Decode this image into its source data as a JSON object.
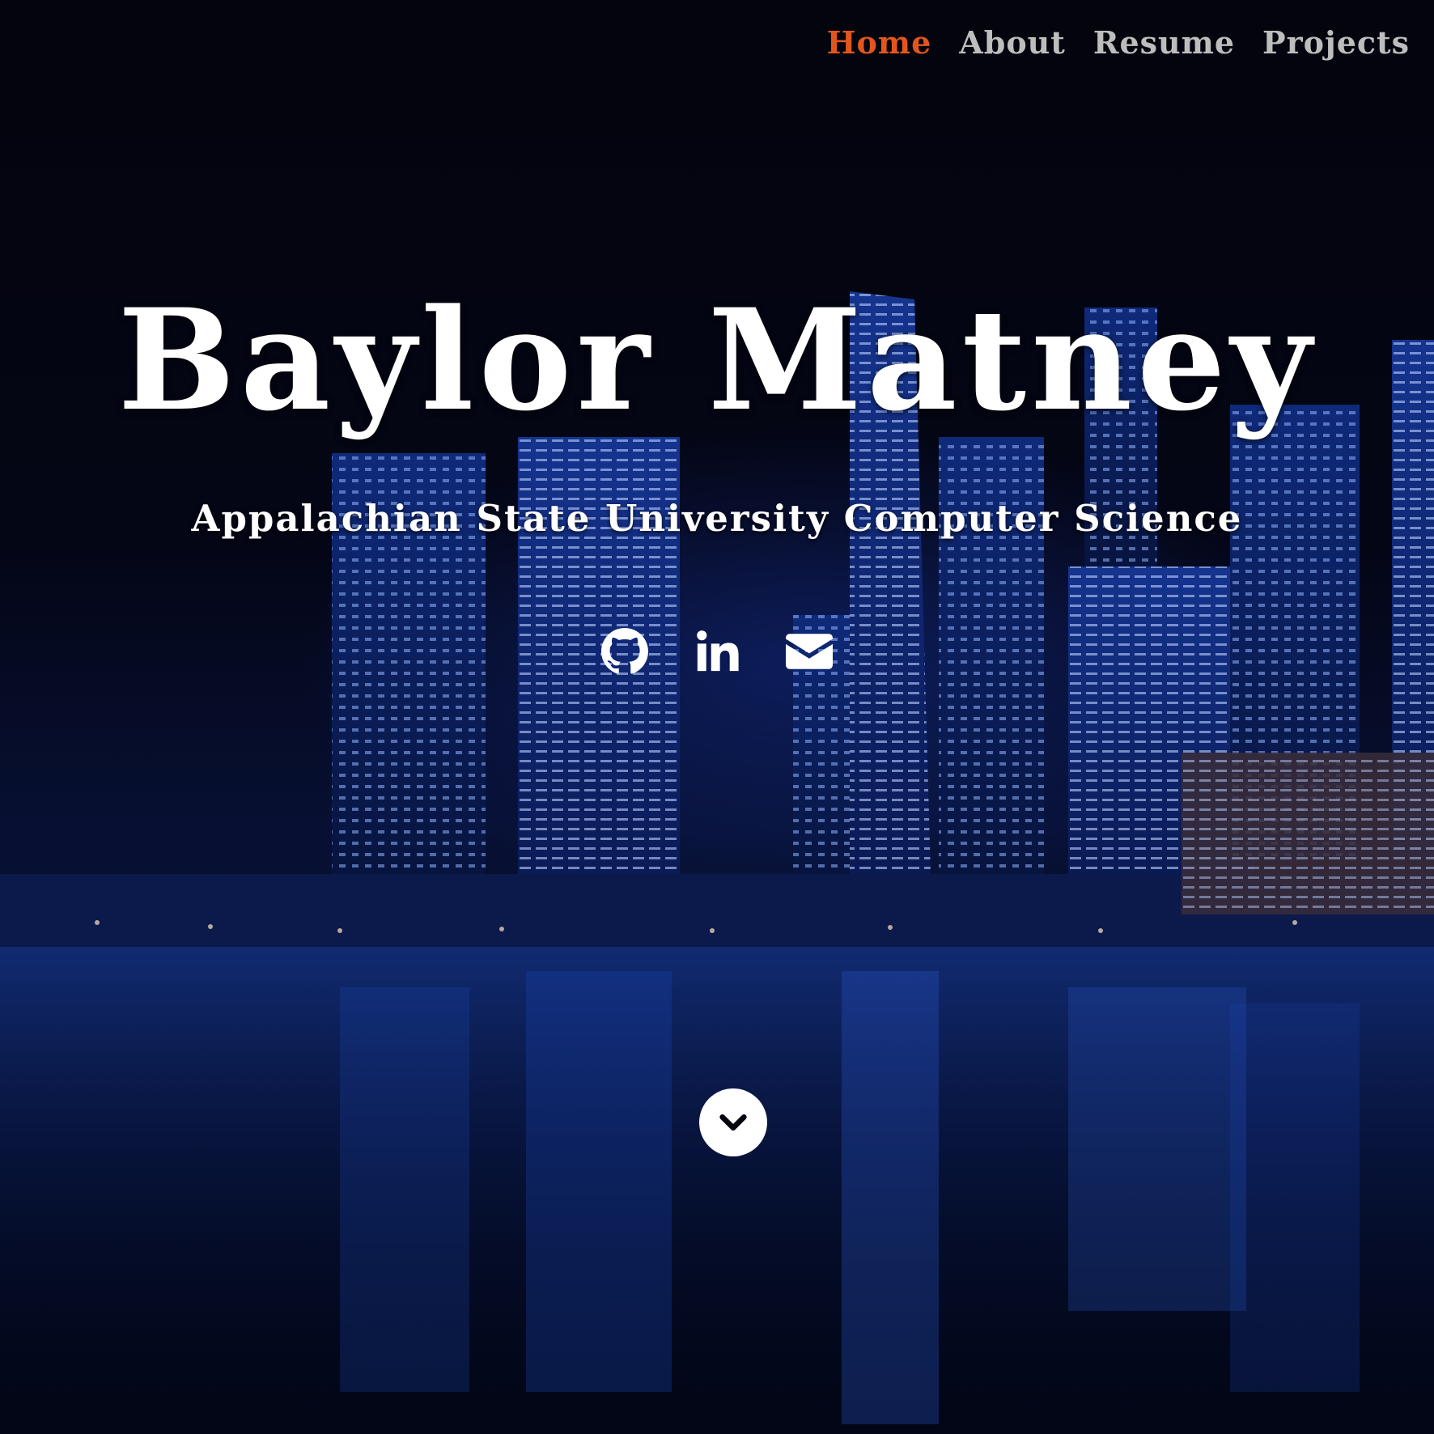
{
  "nav": {
    "items": [
      {
        "label": "Home",
        "active": true
      },
      {
        "label": "About",
        "active": false
      },
      {
        "label": "Resume",
        "active": false
      },
      {
        "label": "Projects",
        "active": false
      }
    ],
    "active_color": "#e2561e",
    "color": "#bdbdbd"
  },
  "hero": {
    "name": "Baylor Matney",
    "subtitle": "Appalachian State University Computer Science",
    "background": "night city skyline reflected on water"
  },
  "social": [
    {
      "icon": "github-icon"
    },
    {
      "icon": "linkedin-icon"
    },
    {
      "icon": "envelope-icon"
    }
  ],
  "scroll": {
    "icon": "chevron-down-icon"
  }
}
